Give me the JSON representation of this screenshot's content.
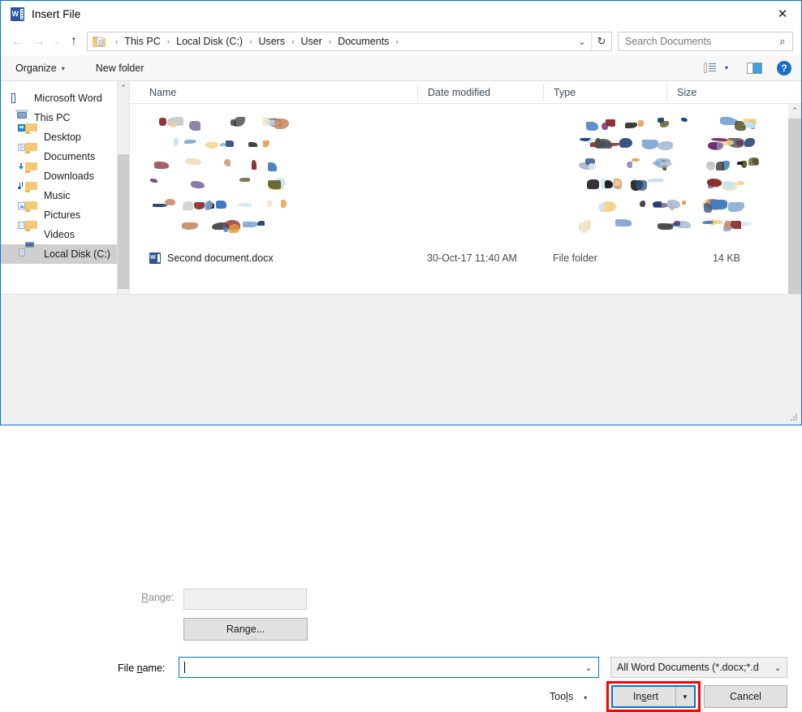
{
  "window": {
    "title": "Insert File",
    "app_icon": "word-icon",
    "close_label": "✕",
    "accent": "#0078d7",
    "highlight_color": "#ff0000"
  },
  "nav": {
    "back_icon": "←",
    "forward_icon": "→",
    "recent_icon": "⌄",
    "up_icon": "↑",
    "breadcrumb": [
      "This PC",
      "Local Disk (C:)",
      "Users",
      "User",
      "Documents"
    ],
    "separator": "›",
    "dropdown_icon": "⌄",
    "refresh_icon": "↻"
  },
  "search": {
    "placeholder": "Search Documents",
    "icon": "⌕"
  },
  "command_bar": {
    "organize": "Organize",
    "new_folder": "New folder",
    "caret": "▾",
    "view_caret": "▾",
    "help_label": "?"
  },
  "sidebar": {
    "items": [
      {
        "label": "Microsoft Word",
        "icon": "word-icon",
        "indent": false,
        "selected": false
      },
      {
        "label": "This PC",
        "icon": "pc-icon",
        "indent": false,
        "selected": false
      },
      {
        "label": "Desktop",
        "icon": "folder-desktop-icon",
        "indent": true,
        "selected": false
      },
      {
        "label": "Documents",
        "icon": "folder-documents-icon",
        "indent": true,
        "selected": false
      },
      {
        "label": "Downloads",
        "icon": "folder-downloads-icon",
        "indent": true,
        "selected": false
      },
      {
        "label": "Music",
        "icon": "folder-music-icon",
        "indent": true,
        "selected": false
      },
      {
        "label": "Pictures",
        "icon": "folder-pictures-icon",
        "indent": true,
        "selected": false
      },
      {
        "label": "Videos",
        "icon": "folder-videos-icon",
        "indent": true,
        "selected": false
      },
      {
        "label": "Local Disk (C:)",
        "icon": "disk-icon",
        "indent": true,
        "selected": true
      }
    ],
    "scroll_up_icon": "⌃"
  },
  "file_list": {
    "columns": [
      "Name",
      "Date modified",
      "Type",
      "Size"
    ],
    "sort_indicator": "⌃",
    "rows": [
      {
        "name": "",
        "date_modified": "",
        "type": "",
        "size": "",
        "redacted": true
      },
      {
        "name": "",
        "date_modified": "",
        "type": "",
        "size": "",
        "redacted": true
      },
      {
        "name": "",
        "date_modified": "",
        "type": "",
        "size": "",
        "redacted": true
      },
      {
        "name": "",
        "date_modified": "",
        "type": "",
        "size": "",
        "redacted": true
      },
      {
        "name": "",
        "date_modified": "",
        "type": "",
        "size": "",
        "redacted": true
      },
      {
        "name": "",
        "date_modified": "",
        "type": "",
        "size": "",
        "redacted": true
      },
      {
        "name": "Second document.docx",
        "date_modified": "30-Oct-17 11:40 AM",
        "type": "File folder",
        "size": "14 KB",
        "redacted": false
      }
    ],
    "scroll_up_icon": "⌃"
  },
  "form": {
    "range_label_pre": "R",
    "range_label_post": "ange:",
    "range_value": "",
    "range_button": "Range...",
    "file_name_label_pre": "File ",
    "file_name_label_key": "n",
    "file_name_label_post": "ame:",
    "file_name_value": "",
    "file_name_dropdown_icon": "⌄",
    "filter_value": "All Word Documents (*.docx;*.d",
    "filter_dropdown_icon": "⌄"
  },
  "actions": {
    "tools_pre": "Too",
    "tools_key": "l",
    "tools_post": "s",
    "tools_caret": "▾",
    "insert_pre": "In",
    "insert_key": "s",
    "insert_post": "ert",
    "insert_split_caret": "▼",
    "cancel": "Cancel"
  }
}
